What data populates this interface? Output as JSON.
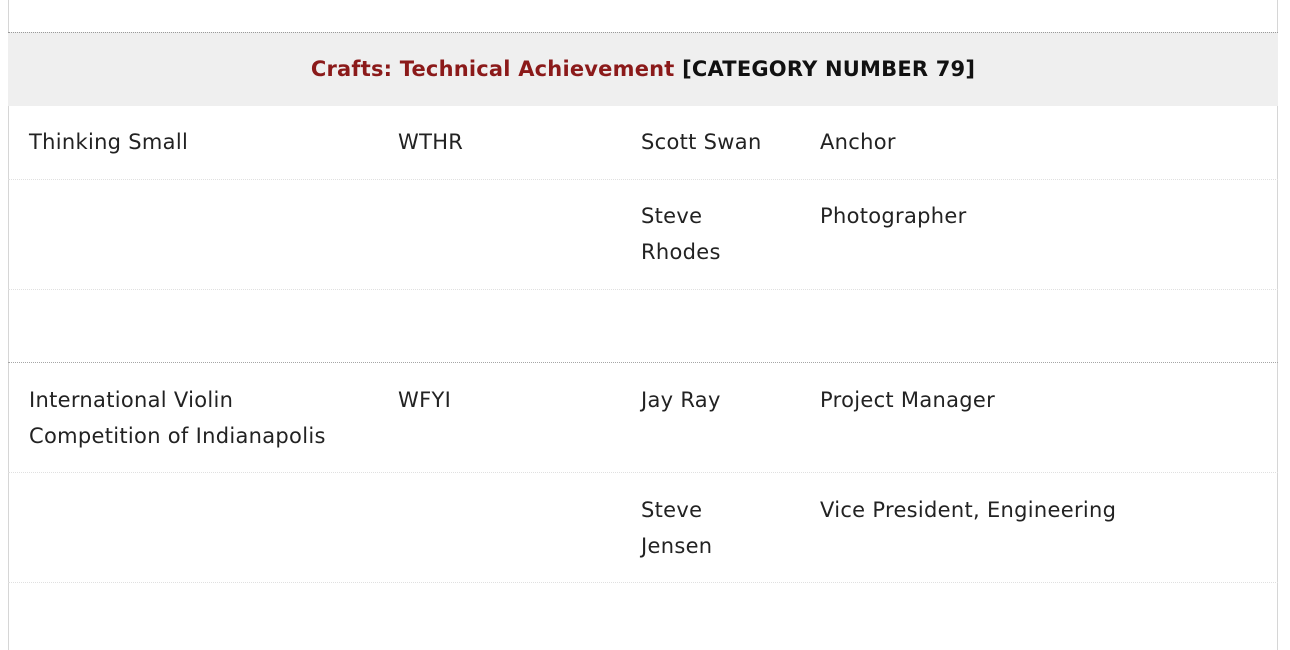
{
  "category": {
    "name": "Crafts: Technical Achievement",
    "number_label": "[CATEGORY NUMBER 79]"
  },
  "entries": [
    {
      "title": "Thinking Small",
      "station": "WTHR",
      "credits": [
        {
          "name": "Scott Swan",
          "role": "Anchor"
        },
        {
          "name": "Steve Rhodes",
          "role": "Photographer"
        }
      ]
    },
    {
      "title": "International Violin Competition of Indianapolis",
      "station": "WFYI",
      "credits": [
        {
          "name": "Jay Ray",
          "role": "Project Manager"
        },
        {
          "name": "Steve Jensen",
          "role": "Vice President, Engineering"
        }
      ]
    }
  ]
}
